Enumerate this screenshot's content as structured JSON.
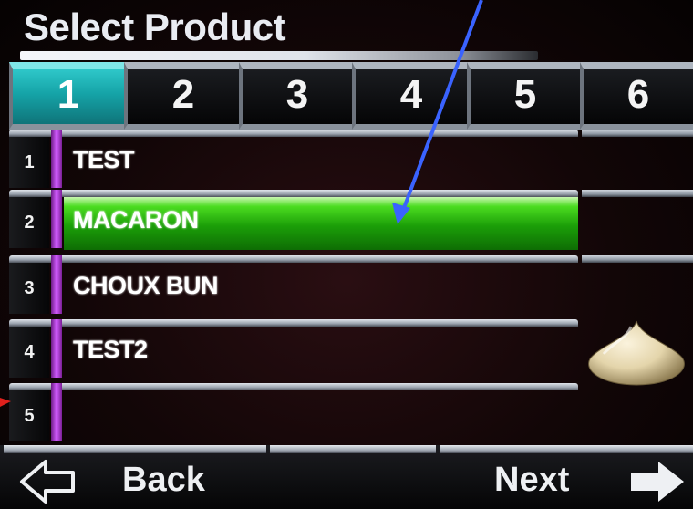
{
  "title": "Select Product",
  "tabs": [
    {
      "label": "1",
      "active": true
    },
    {
      "label": "2",
      "active": false
    },
    {
      "label": "3",
      "active": false
    },
    {
      "label": "4",
      "active": false
    },
    {
      "label": "5",
      "active": false
    },
    {
      "label": "6",
      "active": false
    }
  ],
  "products": [
    {
      "index": "1",
      "name": "TEST",
      "selected": false
    },
    {
      "index": "2",
      "name": "MACARON",
      "selected": true
    },
    {
      "index": "3",
      "name": "CHOUX BUN",
      "selected": false
    },
    {
      "index": "4",
      "name": "TEST2",
      "selected": false
    },
    {
      "index": "5",
      "name": "",
      "selected": false
    }
  ],
  "footer": {
    "back_label": "Back",
    "next_label": "Next"
  },
  "icons": {
    "back": "back-arrow-icon",
    "next": "next-arrow-icon",
    "product_preview": "macaron-icon"
  },
  "colors": {
    "active_tab": "#15a3a7",
    "selected_row": "#1b9e08",
    "row_marker": "#d15cff",
    "annotation_arrow": "#3a63ff",
    "annotation_arrow_red": "#e0201c"
  }
}
